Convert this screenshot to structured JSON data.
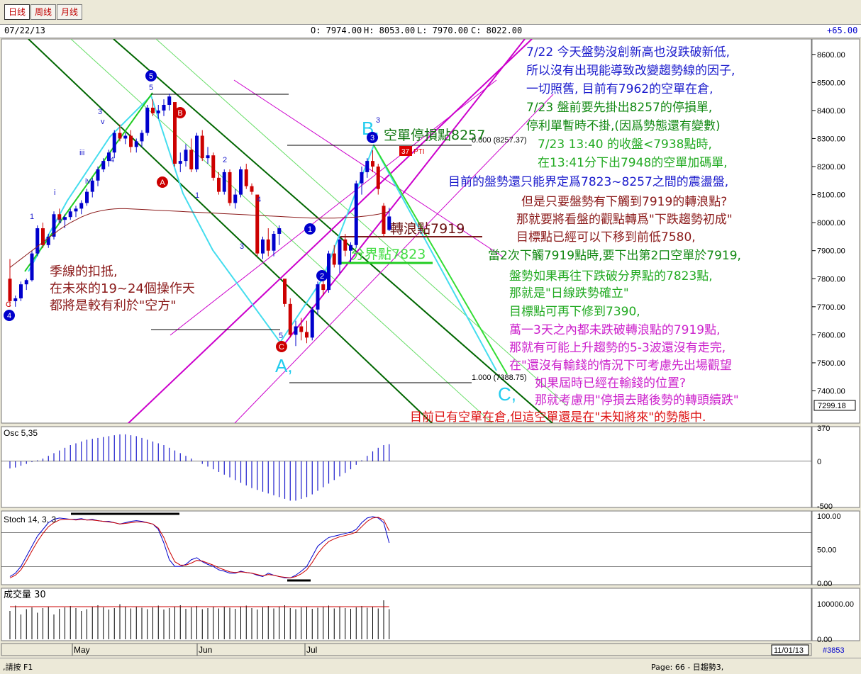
{
  "toolbar": {
    "tabs": [
      {
        "label": "日线",
        "active": true
      },
      {
        "label": "周线",
        "active": false
      },
      {
        "label": "月线",
        "active": false
      }
    ]
  },
  "infobar": {
    "date": "07/22/13",
    "open": "O: 7974.00",
    "high": "H: 8053.00",
    "low": "L: 7970.00",
    "close": "C: 8022.00",
    "change": "+65.00"
  },
  "colors": {
    "up": "#0000cc",
    "down": "#cc0000",
    "green_channel": "#007a00",
    "light_green": "#66dd66",
    "magenta": "#cc00cc",
    "cyan": "#22ccee",
    "ma": "#8b1a1a"
  },
  "chart_data": [
    {
      "type": "candlestick",
      "title": "",
      "ylim": [
        7290,
        8650
      ],
      "ytick_labels": [
        "8600.00",
        "8500.00",
        "8400.00",
        "8300.00",
        "8200.00",
        "8100.00",
        "8000.00",
        "7900.00",
        "7800.00",
        "7700.00",
        "7600.00",
        "7500.00",
        "7400.00"
      ],
      "yticks": [
        8600,
        8500,
        8400,
        8300,
        8200,
        8100,
        8000,
        7900,
        7800,
        7700,
        7600,
        7500,
        7400
      ],
      "x_month_labels": [
        "May",
        "Jun",
        "Jul"
      ],
      "last_price_label": "7299.18",
      "fib_labels": [
        "0.000 (8257.37)",
        "1.000 (7388.75)"
      ],
      "candles": [
        [
          7800,
          7870,
          7700,
          7720
        ],
        [
          7720,
          7740,
          7700,
          7730
        ],
        [
          7730,
          7790,
          7720,
          7780
        ],
        [
          7780,
          7800,
          7760,
          7795
        ],
        [
          7795,
          7900,
          7790,
          7890
        ],
        [
          7890,
          7990,
          7880,
          7980
        ],
        [
          7980,
          8000,
          7910,
          7920
        ],
        [
          7920,
          7960,
          7910,
          7950
        ],
        [
          7950,
          8040,
          7940,
          8030
        ],
        [
          8030,
          8050,
          8000,
          8010
        ],
        [
          8010,
          8030,
          7980,
          8020
        ],
        [
          8020,
          8050,
          8010,
          8040
        ],
        [
          8040,
          8060,
          8020,
          8050
        ],
        [
          8050,
          8080,
          8030,
          8070
        ],
        [
          8070,
          8120,
          8060,
          8110
        ],
        [
          8110,
          8160,
          8090,
          8150
        ],
        [
          8150,
          8200,
          8130,
          8190
        ],
        [
          8190,
          8230,
          8180,
          8220
        ],
        [
          8220,
          8260,
          8200,
          8250
        ],
        [
          8250,
          8330,
          8230,
          8320
        ],
        [
          8320,
          8350,
          8290,
          8300
        ],
        [
          8300,
          8320,
          8280,
          8310
        ],
        [
          8310,
          8330,
          8250,
          8270
        ],
        [
          8270,
          8300,
          8250,
          8290
        ],
        [
          8290,
          8330,
          8270,
          8320
        ],
        [
          8320,
          8420,
          8310,
          8410
        ],
        [
          8410,
          8440,
          8380,
          8390
        ],
        [
          8390,
          8420,
          8370,
          8400
        ],
        [
          8400,
          8440,
          8380,
          8420
        ],
        [
          8420,
          8460,
          8400,
          8450
        ],
        [
          8430,
          8400,
          8200,
          8210
        ],
        [
          8210,
          8250,
          8180,
          8220
        ],
        [
          8220,
          8280,
          8200,
          8260
        ],
        [
          8260,
          8300,
          8180,
          8190
        ],
        [
          8190,
          8320,
          8180,
          8310
        ],
        [
          8310,
          8330,
          8220,
          8230
        ],
        [
          8230,
          8270,
          8210,
          8240
        ],
        [
          8240,
          8250,
          8150,
          8160
        ],
        [
          8160,
          8180,
          8100,
          8110
        ],
        [
          8110,
          8190,
          8100,
          8180
        ],
        [
          8180,
          8190,
          8060,
          8070
        ],
        [
          8070,
          8120,
          8050,
          8100
        ],
        [
          8100,
          8200,
          8090,
          8190
        ],
        [
          8190,
          8210,
          8120,
          8130
        ],
        [
          8130,
          8140,
          8100,
          8110
        ],
        [
          8100,
          8050,
          7880,
          7890
        ],
        [
          7890,
          7950,
          7870,
          7940
        ],
        [
          7940,
          7980,
          7880,
          7900
        ],
        [
          7900,
          7970,
          7880,
          7960
        ],
        [
          7960,
          7990,
          7920,
          7980
        ],
        [
          7800,
          7790,
          7700,
          7710
        ],
        [
          7710,
          7730,
          7590,
          7600
        ],
        [
          7600,
          7650,
          7560,
          7630
        ],
        [
          7630,
          7660,
          7580,
          7610
        ],
        [
          7610,
          7650,
          7570,
          7590
        ],
        [
          7590,
          7700,
          7580,
          7690
        ],
        [
          7690,
          7790,
          7670,
          7780
        ],
        [
          7780,
          7820,
          7740,
          7760
        ],
        [
          7760,
          7900,
          7750,
          7890
        ],
        [
          7890,
          7920,
          7840,
          7850
        ],
        [
          7850,
          7950,
          7820,
          7940
        ],
        [
          7940,
          7960,
          7880,
          7900
        ],
        [
          7900,
          7930,
          7860,
          7920
        ],
        [
          7920,
          8150,
          7910,
          8140
        ],
        [
          8140,
          8200,
          8100,
          8180
        ],
        [
          8180,
          8230,
          8160,
          8220
        ],
        [
          8220,
          8258,
          8180,
          8200
        ],
        [
          8200,
          8210,
          8100,
          8120
        ],
        [
          8060,
          8070,
          7950,
          7960
        ],
        [
          7974,
          8053,
          7970,
          8022
        ]
      ],
      "moving_average": [
        7840,
        7855,
        7870,
        7885,
        7900,
        7915,
        7930,
        7945,
        7960,
        7975,
        7988,
        8000,
        8010,
        8020,
        8028,
        8035,
        8040,
        8044,
        8047,
        8049,
        8050,
        8050,
        8049,
        8048,
        8047,
        8046,
        8045,
        8044,
        8043,
        8042,
        8041,
        8040,
        8039,
        8038,
        8037,
        8036,
        8035,
        8034,
        8033,
        8032,
        8031,
        8030,
        8029,
        8028,
        8027,
        8026,
        8025,
        8024,
        8023,
        8022,
        8021,
        8020,
        8019,
        8018,
        8017,
        8016,
        8016,
        8016,
        8016,
        8016,
        8017,
        8018,
        8019,
        8020,
        8022,
        8024,
        8027,
        8030,
        8034,
        8040
      ]
    },
    {
      "type": "bar",
      "title": "Osc 5,35",
      "ytick_labels": [
        "370",
        "0",
        "-500"
      ],
      "ylim": [
        -500,
        370
      ],
      "values": [
        -80,
        -70,
        -50,
        -30,
        -10,
        10,
        30,
        60,
        90,
        120,
        150,
        180,
        200,
        220,
        240,
        250,
        260,
        270,
        280,
        290,
        300,
        300,
        290,
        280,
        260,
        240,
        220,
        200,
        180,
        150,
        120,
        90,
        60,
        30,
        0,
        -30,
        -60,
        -90,
        -120,
        -150,
        -180,
        -210,
        -240,
        -270,
        -300,
        -320,
        -340,
        -360,
        -380,
        -400,
        -420,
        -440,
        -440,
        -420,
        -400,
        -370,
        -330,
        -290,
        -250,
        -210,
        -170,
        -130,
        -90,
        -40,
        10,
        60,
        110,
        150,
        180,
        190
      ]
    },
    {
      "type": "line",
      "title": "Stoch 14, 3, 3",
      "ylim": [
        0,
        100
      ],
      "ytick_labels": [
        "100.00",
        "50.00",
        "0.00"
      ],
      "series": [
        {
          "values": [
            10,
            15,
            25,
            40,
            55,
            70,
            80,
            90,
            95,
            97,
            96,
            95,
            95,
            96,
            94,
            95,
            93,
            92,
            92,
            90,
            88,
            90,
            92,
            93,
            92,
            90,
            88,
            80,
            60,
            35,
            25,
            25,
            28,
            35,
            38,
            32,
            28,
            25,
            20,
            18,
            15,
            15,
            18,
            16,
            15,
            12,
            10,
            15,
            12,
            10,
            8,
            8,
            12,
            18,
            25,
            40,
            55,
            62,
            68,
            70,
            72,
            74,
            76,
            80,
            90,
            97,
            99,
            97,
            90,
            60
          ]
        },
        {
          "values": [
            8,
            12,
            20,
            33,
            48,
            62,
            74,
            84,
            90,
            94,
            95,
            95,
            94,
            95,
            94,
            94,
            93,
            92,
            91,
            90,
            88,
            89,
            90,
            91,
            91,
            90,
            88,
            82,
            68,
            48,
            32,
            27,
            27,
            30,
            34,
            33,
            30,
            27,
            23,
            20,
            17,
            16,
            17,
            16,
            15,
            13,
            11,
            13,
            12,
            10,
            9,
            8,
            10,
            14,
            20,
            31,
            44,
            54,
            62,
            66,
            69,
            71,
            73,
            76,
            84,
            92,
            97,
            98,
            94,
            78
          ]
        }
      ]
    },
    {
      "type": "bar",
      "title": "成交量 30",
      "ytick_labels": [
        "100000.00",
        "0.00"
      ],
      "ylim": [
        0,
        140000
      ],
      "values": [
        80000,
        95000,
        70000,
        85000,
        90000,
        75000,
        88000,
        92000,
        70000,
        86000,
        90000,
        94000,
        88000,
        80000,
        85000,
        92000,
        96000,
        90000,
        84000,
        88000,
        99000,
        91000,
        87000,
        93000,
        89000,
        85000,
        90000,
        95000,
        84000,
        88000,
        92000,
        96000,
        86000,
        90000,
        94000,
        85000,
        88000,
        91000,
        87000,
        93000,
        89000,
        86000,
        92000,
        95000,
        88000,
        84000,
        90000,
        94000,
        87000,
        91000,
        96000,
        88000,
        85000,
        90000,
        93000,
        86000,
        89000,
        92000,
        95000,
        87000,
        91000,
        88000,
        86000,
        90000,
        94000,
        89000,
        92000,
        87000,
        110000,
        85000
      ],
      "average": [
        92000,
        92000,
        92000,
        92000,
        92000,
        92000,
        92000,
        92000,
        92000,
        92000,
        92000,
        92000,
        92000,
        92000,
        92000,
        92000,
        92000,
        92000,
        92000,
        92000,
        92000,
        92000,
        92000,
        92000,
        92000,
        92000,
        92000,
        92000,
        92000,
        92000,
        92000,
        92000,
        92000,
        92000,
        92000,
        92000,
        92000,
        92000,
        92000,
        92000,
        92000,
        92000,
        92000,
        92000,
        92000,
        92000,
        92000,
        92000,
        92000,
        92000,
        92000,
        92000,
        92000,
        92000,
        92000,
        92000,
        92000,
        92000,
        92000,
        92000,
        92000,
        92000,
        92000,
        92000,
        92000,
        92000,
        92000,
        92000,
        92000,
        92000
      ]
    }
  ],
  "wave_labels": {
    "A": "A,",
    "B": "B,",
    "C": "C,"
  },
  "price_annotations": {
    "stop_loss": "空單停損點8257",
    "turn": "轉浪點7919",
    "boundary": "分界點7823",
    "pti": "37",
    "pti_label": "PTI"
  },
  "left_note": {
    "lines": [
      "季線的扣抵,",
      "在未來的19~24個操作天",
      "都將是較有利於\"空方\""
    ]
  },
  "commentary": [
    {
      "text": "7/22 今天盤勢沒創新高也沒跌破新低,",
      "color": "#1a1acc"
    },
    {
      "text": "所以沒有出現能導致改變趨勢線的因子,",
      "color": "#1a1acc"
    },
    {
      "text": "一切照舊, 目前有7962的空單在倉,",
      "color": "#1a1acc"
    },
    {
      "text": "7/23 盤前要先掛出8257的停損單,",
      "color": "#118811"
    },
    {
      "text": "停利單暫時不掛,(因爲勢態還有變數)",
      "color": "#118811"
    },
    {
      "text": "7/23 13:40 的收盤<7938點時,",
      "color": "#22aa22"
    },
    {
      "text": "在13:41分下出7948的空單加碼單,",
      "color": "#22aa22"
    },
    {
      "text": "目前的盤勢還只能界定爲7823~8257之間的震盪盤,",
      "color": "#1a1acc"
    },
    {
      "text": "但是只要盤勢有下觸到7919的轉浪點?",
      "color": "#8b1a1a"
    },
    {
      "text": "那就要將看盤的觀點轉爲\"下跌趨勢初成\"",
      "color": "#8b1a1a"
    },
    {
      "text": "目標點已經可以下移到前低7580,",
      "color": "#8b1a1a"
    },
    {
      "text": "當2次下觸7919點時,要下出第2口空單於7919,",
      "color": "#118811"
    },
    {
      "text": "盤勢如果再往下跌破分界點的7823點,",
      "color": "#22aa22"
    },
    {
      "text": "那就是\"日線跌勢確立\"",
      "color": "#22aa22"
    },
    {
      "text": "目標點可再下修到7390,",
      "color": "#22aa22"
    },
    {
      "text": "萬一3天之內都未跌破轉浪點的7919點,",
      "color": "#cc22cc"
    },
    {
      "text": "那就有可能上升趨勢的5-3波還沒有走完,",
      "color": "#cc22cc"
    },
    {
      "text": "在\"還沒有輸錢的情況下可考慮先出場觀望",
      "color": "#cc22cc"
    },
    {
      "text": "如果屆時已經在輸錢的位置?",
      "color": "#cc22cc"
    },
    {
      "text": "那就考慮用\"停損去賭後勢的轉頭續跌\"",
      "color": "#cc22cc"
    },
    {
      "text": "目前已有空單在倉,但這空單還是在\"未知將來\"的勢態中.",
      "color": "#dd1111"
    }
  ],
  "elliott_labels": {
    "w1": "1",
    "w2": "2",
    "w3": "3",
    "w4": "4",
    "w5": "5",
    "i": "i",
    "ii": "ii",
    "iii": "iii",
    "iv": "iv",
    "v": "v",
    "A": "A",
    "B": "B",
    "C": "C"
  },
  "bottom": {
    "date_box": "11/01/13",
    "code": "#3853"
  },
  "statusbar": {
    "left": ",請按 F1",
    "right": "Page: 66 - 日趨勢3,"
  }
}
